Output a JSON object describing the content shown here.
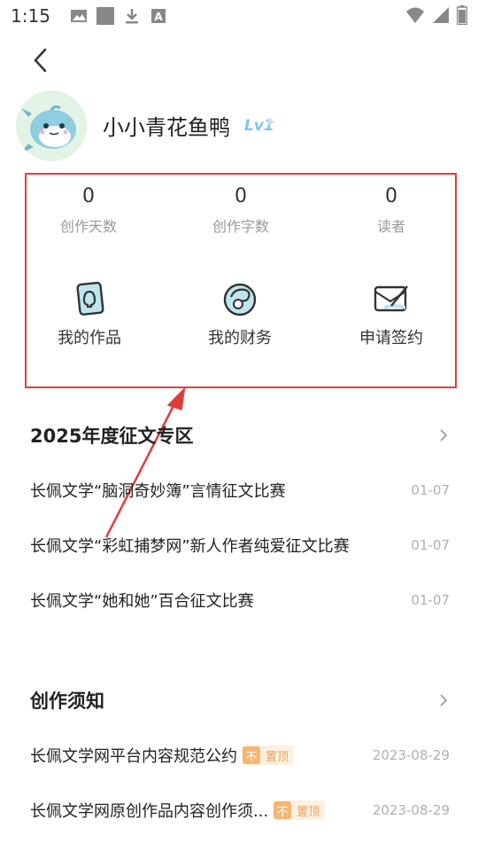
{
  "status_bar": {
    "time": "1:15",
    "left_icons": [
      "image-icon",
      "square-icon",
      "download-icon",
      "font-icon"
    ],
    "right_icons": [
      "wifi-icon",
      "signal-icon",
      "battery-icon"
    ]
  },
  "profile": {
    "username": "小小青花鱼鸭",
    "level": "Lv1"
  },
  "stats": [
    {
      "value": "0",
      "label": "创作天数"
    },
    {
      "value": "0",
      "label": "创作字数"
    },
    {
      "value": "0",
      "label": "读者"
    }
  ],
  "actions": [
    {
      "label": "我的作品",
      "icon": "works-icon"
    },
    {
      "label": "我的财务",
      "icon": "finance-icon"
    },
    {
      "label": "申请签约",
      "icon": "sign-icon"
    }
  ],
  "contest_section": {
    "title": "2025年度征文专区",
    "items": [
      {
        "title": "长佩文学“脑洞奇妙簿”言情征文比赛",
        "date": "01-07"
      },
      {
        "title": "长佩文学“彩虹捕梦网”新人作者纯爱征文比赛",
        "date": "01-07"
      },
      {
        "title": "长佩文学“她和她”百合征文比赛",
        "date": "01-07"
      }
    ]
  },
  "notice_section": {
    "title": "创作须知",
    "items": [
      {
        "title": "长佩文学网平台内容规范公约",
        "badge": "置顶",
        "badge_icon": "不",
        "date": "2023-08-29"
      },
      {
        "title": "长佩文学网原创作品内容创作须...",
        "badge": "置顶",
        "badge_icon": "不",
        "date": "2023-08-29"
      }
    ]
  },
  "colors": {
    "highlight_border": "#e13c3c",
    "annotation_arrow": "#e13c3c",
    "pin_badge": "#f5b672",
    "date_text": "#b0b0b0"
  }
}
